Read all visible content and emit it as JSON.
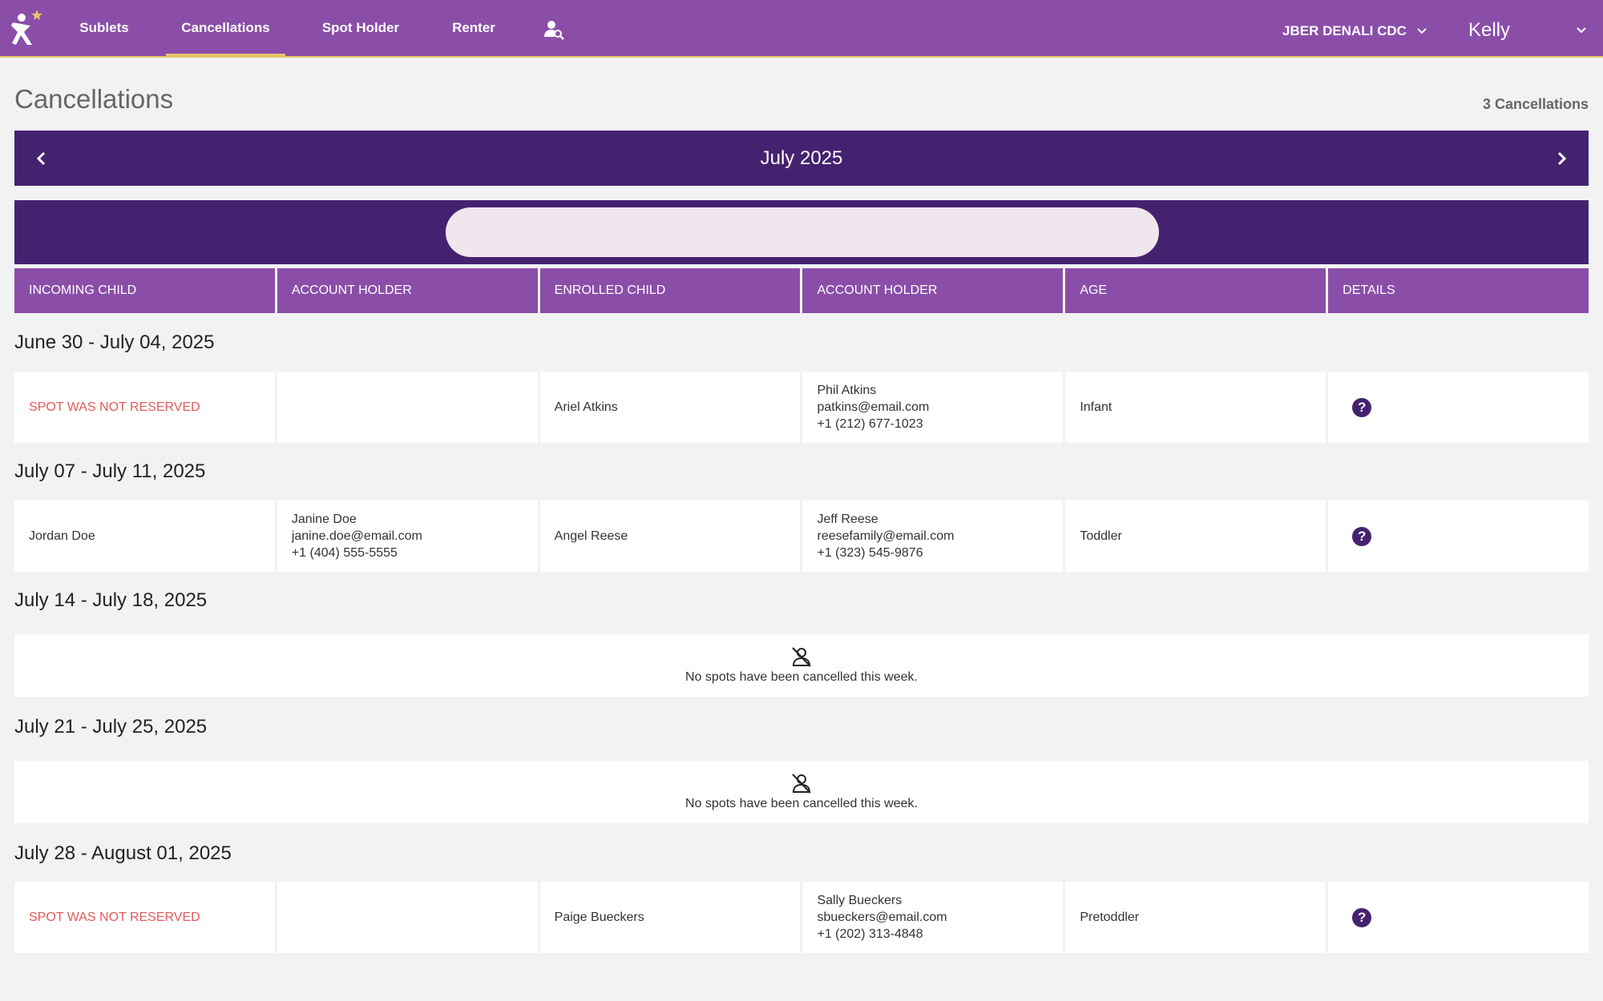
{
  "nav": {
    "tabs": [
      {
        "label": "Sublets"
      },
      {
        "label": "Cancellations",
        "active": true
      },
      {
        "label": "Spot Holder"
      },
      {
        "label": "Renter"
      }
    ],
    "search_person_icon": "person-search-icon",
    "center": "JBER DENALI CDC",
    "user": "Kelly"
  },
  "page": {
    "title": "Cancellations",
    "count": "3 Cancellations"
  },
  "month": {
    "label": "July 2025"
  },
  "search": {
    "value": "",
    "placeholder": ""
  },
  "table": {
    "headers": [
      "Incoming Child",
      "Account Holder",
      "Enrolled Child",
      "Account Holder",
      "Age",
      "Details"
    ]
  },
  "weeks": [
    {
      "label": "June 30 - July 04, 2025",
      "incoming": "SPOT WAS NOT RESERVED",
      "incoming_holder": {
        "name": "",
        "email": "",
        "phone": ""
      },
      "enrolled": "Ariel Atkins",
      "enrolled_holder": {
        "name": "Phil Atkins",
        "email": "patkins@email.com",
        "phone": "+1 (212) 677-1023"
      },
      "age": "Infant"
    },
    {
      "label": "July 07 - July 11, 2025",
      "incoming": "Jordan Doe",
      "incoming_holder": {
        "name": "Janine Doe",
        "email": "janine.doe@email.com",
        "phone": "+1 (404) 555-5555"
      },
      "enrolled": "Angel Reese",
      "enrolled_holder": {
        "name": "Jeff Reese",
        "email": "reesefamily@email.com",
        "phone": "+1 (323) 545-9876"
      },
      "age": "Toddler"
    },
    {
      "label": "July 14 - July 18, 2025",
      "empty_message": "No spots have been cancelled this week."
    },
    {
      "label": "July 21 - July 25, 2025",
      "empty_message": "No spots have been cancelled this week."
    },
    {
      "label": "July 28 - August 01, 2025",
      "incoming": "SPOT WAS NOT RESERVED",
      "incoming_holder": {
        "name": "",
        "email": "",
        "phone": ""
      },
      "enrolled": "Paige Bueckers",
      "enrolled_holder": {
        "name": "Sally Bueckers",
        "email": "sbueckers@email.com",
        "phone": "+1 (202) 313-4848"
      },
      "age": "Pretoddler"
    }
  ],
  "colors": {
    "topbar": "#8a4ea8",
    "dark_purple": "#452270",
    "accent_gold": "#e8c46a",
    "warning_red": "#e05a5a"
  }
}
